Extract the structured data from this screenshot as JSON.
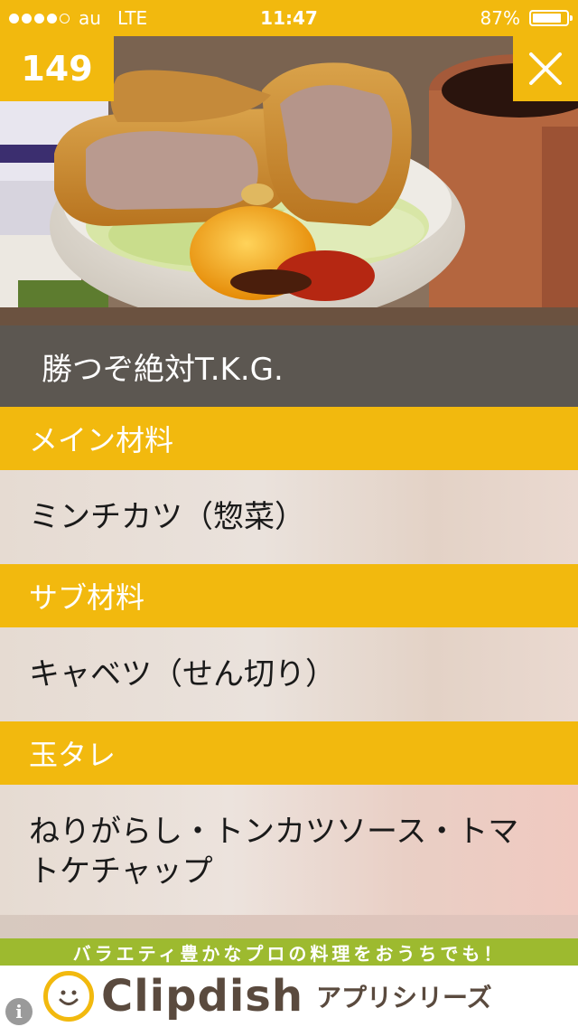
{
  "status_bar": {
    "carrier": "au",
    "network": "LTE",
    "time": "11:47",
    "battery_percent": "87%",
    "battery_level": 0.87,
    "signal_bars_filled": 4,
    "signal_bars_total": 5
  },
  "counter": {
    "value": "149"
  },
  "recipe": {
    "title": "勝つぞ絶対T.K.G."
  },
  "sections": [
    {
      "header": "メイン材料",
      "item": "ミンチカツ（惣菜）"
    },
    {
      "header": "サブ材料",
      "item": "キャベツ（せん切り）"
    },
    {
      "header": "玉タレ",
      "item_lines": [
        "ねりがらし・トンカツソース・トマ",
        "トケチャップ"
      ]
    }
  ],
  "ad": {
    "tagline": "バラエティ豊かなプロの料理をおうちでも！",
    "brand": "Clipdish",
    "series": "アプリシリーズ"
  },
  "colors": {
    "accent": "#f2b90e",
    "title_bar": "#5c5751",
    "ad_green": "#9dba2f",
    "brand_text": "#5a4a3e"
  },
  "icons": {
    "close": "close-icon",
    "info": "info-icon",
    "logo": "clipdish-logo-icon"
  }
}
